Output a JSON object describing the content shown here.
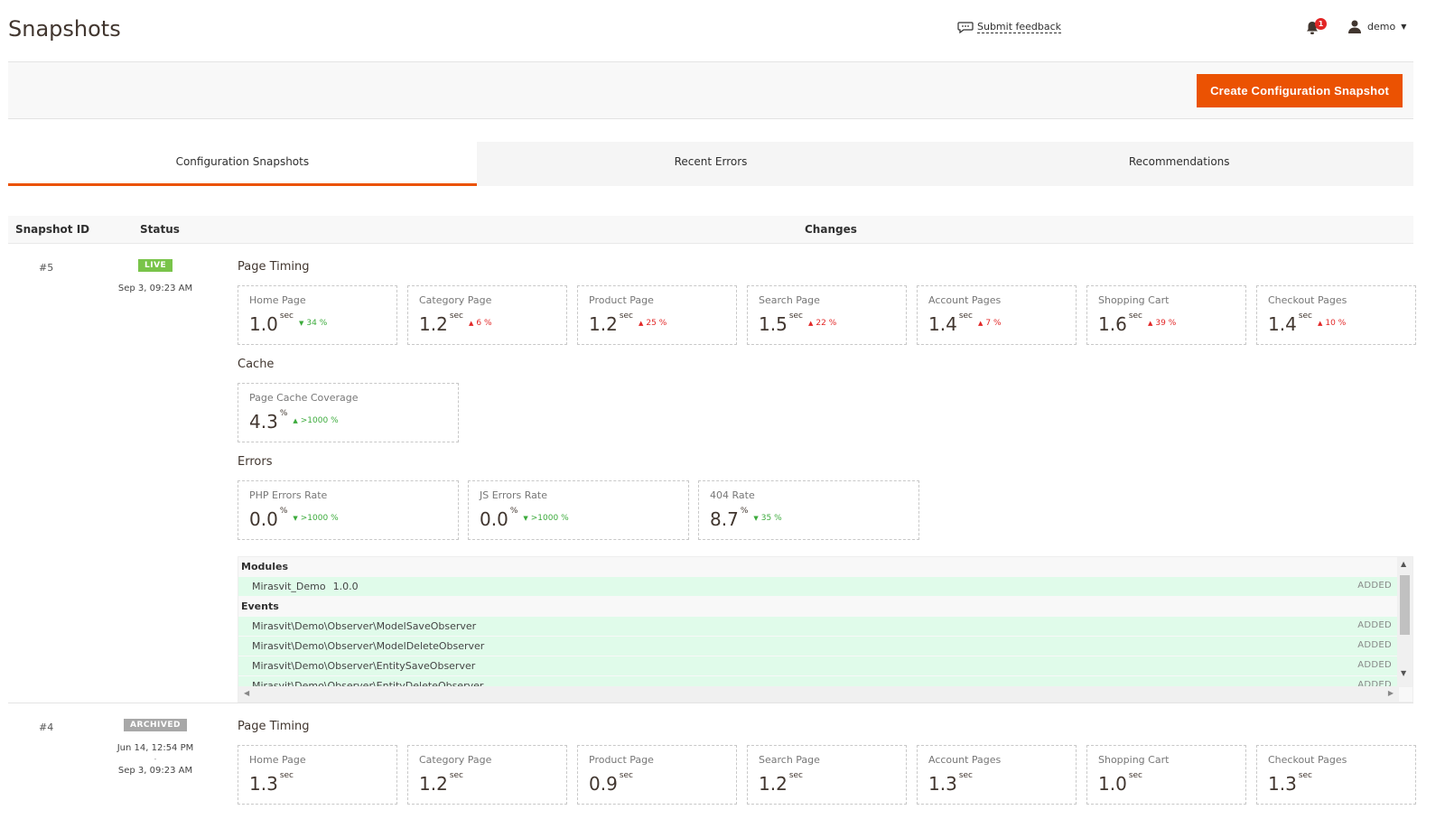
{
  "header": {
    "title": "Snapshots",
    "feedback_label": "Submit feedback",
    "notifications_count": "1",
    "user_name": "demo"
  },
  "actions": {
    "create_label": "Create Configuration Snapshot"
  },
  "tabs": [
    {
      "label": "Configuration Snapshots",
      "active": true
    },
    {
      "label": "Recent Errors",
      "active": false
    },
    {
      "label": "Recommendations",
      "active": false
    }
  ],
  "table": {
    "columns": [
      "Snapshot ID",
      "Status",
      "Changes"
    ]
  },
  "snapshots": [
    {
      "id": "#5",
      "status": "LIVE",
      "date": "Sep 3, 09:23 AM",
      "page_timing_title": "Page Timing",
      "page_timing": [
        {
          "label": "Home Page",
          "value": "1.0",
          "unit": "sec",
          "delta": "34 %",
          "dir": "down"
        },
        {
          "label": "Category Page",
          "value": "1.2",
          "unit": "sec",
          "delta": "6 %",
          "dir": "up"
        },
        {
          "label": "Product Page",
          "value": "1.2",
          "unit": "sec",
          "delta": "25 %",
          "dir": "up"
        },
        {
          "label": "Search Page",
          "value": "1.5",
          "unit": "sec",
          "delta": "22 %",
          "dir": "up"
        },
        {
          "label": "Account Pages",
          "value": "1.4",
          "unit": "sec",
          "delta": "7 %",
          "dir": "up"
        },
        {
          "label": "Shopping Cart",
          "value": "1.6",
          "unit": "sec",
          "delta": "39 %",
          "dir": "up"
        },
        {
          "label": "Checkout Pages",
          "value": "1.4",
          "unit": "sec",
          "delta": "10 %",
          "dir": "up"
        }
      ],
      "cache_title": "Cache",
      "cache": [
        {
          "label": "Page Cache Coverage",
          "value": "4.3",
          "unit": "%",
          "delta": ">1000 %",
          "dir": "up-good"
        }
      ],
      "errors_title": "Errors",
      "errors": [
        {
          "label": "PHP Errors Rate",
          "value": "0.0",
          "unit": "%",
          "delta": ">1000 %",
          "dir": "down"
        },
        {
          "label": "JS Errors Rate",
          "value": "0.0",
          "unit": "%",
          "delta": ">1000 %",
          "dir": "down"
        },
        {
          "label": "404 Rate",
          "value": "8.7",
          "unit": "%",
          "delta": "35 %",
          "dir": "down"
        }
      ],
      "changes": {
        "modules_title": "Modules",
        "modules": [
          {
            "name": "Mirasvit_Demo",
            "version": "1.0.0",
            "action": "ADDED"
          }
        ],
        "events_title": "Events",
        "events": [
          {
            "name": "Mirasvit\\Demo\\Observer\\ModelSaveObserver",
            "action": "ADDED"
          },
          {
            "name": "Mirasvit\\Demo\\Observer\\ModelDeleteObserver",
            "action": "ADDED"
          },
          {
            "name": "Mirasvit\\Demo\\Observer\\EntitySaveObserver",
            "action": "ADDED"
          },
          {
            "name": "Mirasvit\\Demo\\Observer\\EntityDeleteObserver",
            "action": "ADDED"
          }
        ]
      }
    },
    {
      "id": "#4",
      "status": "ARCHIVED",
      "date_from": "Jun 14, 12:54 PM",
      "date_sep": "-",
      "date_to": "Sep 3, 09:23 AM",
      "page_timing_title": "Page Timing",
      "page_timing": [
        {
          "label": "Home Page",
          "value": "1.3",
          "unit": "sec"
        },
        {
          "label": "Category Page",
          "value": "1.2",
          "unit": "sec"
        },
        {
          "label": "Product Page",
          "value": "0.9",
          "unit": "sec"
        },
        {
          "label": "Search Page",
          "value": "1.2",
          "unit": "sec"
        },
        {
          "label": "Account Pages",
          "value": "1.3",
          "unit": "sec"
        },
        {
          "label": "Shopping Cart",
          "value": "1.0",
          "unit": "sec"
        },
        {
          "label": "Checkout Pages",
          "value": "1.3",
          "unit": "sec"
        }
      ]
    }
  ]
}
